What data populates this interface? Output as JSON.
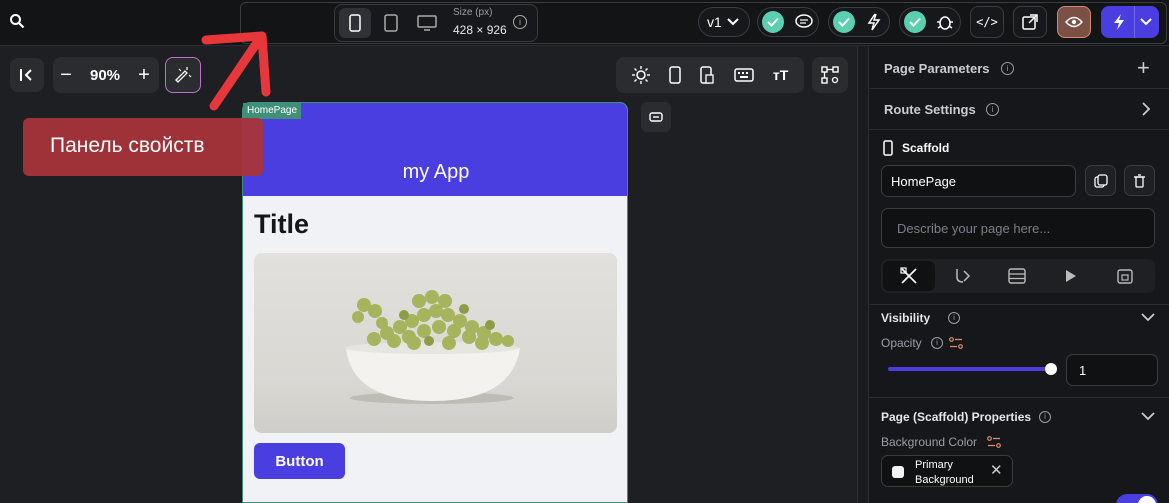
{
  "topbar": {
    "size_label": "Size (px)",
    "size_value": "428 × 926",
    "version": "v1"
  },
  "canvas_toolbar": {
    "zoom": "90%"
  },
  "annotation": {
    "text": "Панель свойств"
  },
  "phone": {
    "page_tag": "HomePage",
    "app_title": "my App",
    "title": "Title",
    "button_label": "Button"
  },
  "panel": {
    "page_parameters": "Page Parameters",
    "route_settings": "Route Settings",
    "scaffold_label": "Scaffold",
    "page_name": "HomePage",
    "describe_placeholder": "Describe your page here...",
    "visibility": "Visibility",
    "opacity_label": "Opacity",
    "opacity_value": "1",
    "page_props": "Page (Scaffold) Properties",
    "bg_color_label": "Background Color",
    "bg_color_value_line1": "Primary",
    "bg_color_value_line2": "Background"
  },
  "colors": {
    "accent": "#4a3ee0",
    "check": "#5bd0b0",
    "annotation_bg": "#a6343a",
    "arrow": "#e8373a"
  }
}
